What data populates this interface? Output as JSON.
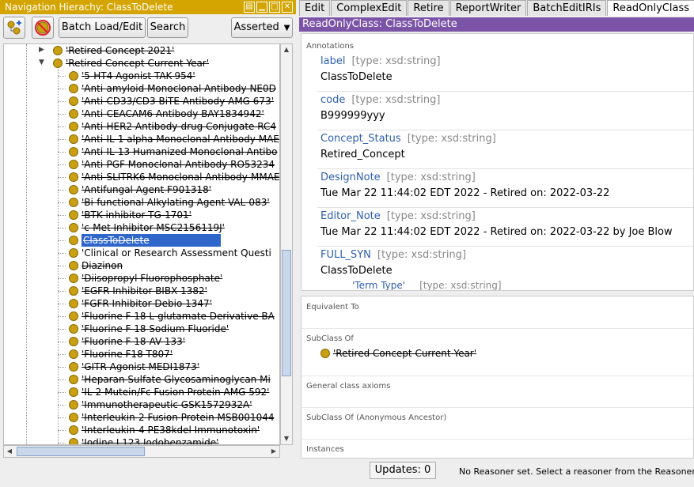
{
  "nav": {
    "title": "Navigation Hierachy: ClassToDelete",
    "batch_label": "Batch Load/Edit",
    "search_label": "Search",
    "asserted_label": "Asserted"
  },
  "tree": {
    "parents": [
      {
        "label": "'Retired Concept 2021'",
        "retired": true,
        "expanded": false
      },
      {
        "label": "'Retired Concept Current Year'",
        "retired": true,
        "expanded": true
      }
    ],
    "children": [
      {
        "label": "'5-HT4 Agonist TAK-954'",
        "retired": true
      },
      {
        "label": "'Anti-amyloid Monoclonal Antibody NE0D",
        "retired": true
      },
      {
        "label": "'Anti-CD33/CD3 BiTE Antibody AMG 673'",
        "retired": true
      },
      {
        "label": "'Anti-CEACAM6 Antibody BAY1834942'",
        "retired": true
      },
      {
        "label": "'Anti-HER2 Antibody-drug Conjugate RC4",
        "retired": true
      },
      {
        "label": "'Anti-IL-1 alpha Monoclonal Antibody MAE",
        "retired": true
      },
      {
        "label": "'Anti-IL-13 Humanized Monoclonal Antibo",
        "retired": true
      },
      {
        "label": "'Anti-PGF Monoclonal Antibody RO53234",
        "retired": true
      },
      {
        "label": "'Anti-SLITRK6 Monoclonal Antibody-MMAE",
        "retired": true
      },
      {
        "label": "'Antifungal Agent F901318'",
        "retired": true
      },
      {
        "label": "'Bi-functional Alkylating Agent VAL-083'",
        "retired": true
      },
      {
        "label": "'BTK inhibitor TG-1701'",
        "retired": true
      },
      {
        "label": "'c-Met Inhibitor MSC2156119J'",
        "retired": true
      },
      {
        "label": "ClassToDelete",
        "retired": true,
        "selected": true
      },
      {
        "label": "'Clinical or Research Assessment Questi",
        "retired": false
      },
      {
        "label": "Diazinon",
        "retired": true
      },
      {
        "label": "'Diisopropyl Fluorophosphate'",
        "retired": true
      },
      {
        "label": "'EGFR Inhibitor BIBX 1382'",
        "retired": true
      },
      {
        "label": "'FGFR Inhibitor Debio 1347'",
        "retired": true
      },
      {
        "label": "'Fluorine F 18 L-glutamate Derivative BA",
        "retired": true
      },
      {
        "label": "'Fluorine F 18 Sodium Fluoride'",
        "retired": true
      },
      {
        "label": "'Fluorine F 18-AV-133'",
        "retired": true
      },
      {
        "label": "'Fluorine F18 T807'",
        "retired": true
      },
      {
        "label": "'GITR Agonist MEDI1873'",
        "retired": true
      },
      {
        "label": "'Heparan Sulfate Glycosaminoglycan Mi",
        "retired": true
      },
      {
        "label": "'IL-2 Mutein/Fc Fusion Protein AMG 592'",
        "retired": true
      },
      {
        "label": "'Immunotherapeutic GSK1572932A'",
        "retired": true
      },
      {
        "label": "'Interleukin-2 Fusion Protein MSB001044",
        "retired": true
      },
      {
        "label": "'Interleukin-4 PE38kdel Immunotoxin'",
        "retired": true
      },
      {
        "label": "'Iodine I 123 Iodobenzamide'",
        "retired": true
      }
    ]
  },
  "tabs": [
    "Edit",
    "ComplexEdit",
    "Retire",
    "ReportWriter",
    "BatchEditIRIs",
    "ReadOnlyClass"
  ],
  "readonly": {
    "title": "ReadOnlyClass: ClassToDelete",
    "annotations_title": "Annotations",
    "annotations": [
      {
        "prop": "label",
        "type": "[type: xsd:string]",
        "value": "ClassToDelete"
      },
      {
        "prop": "code",
        "type": "[type: xsd:string]",
        "value": "B999999yyy"
      },
      {
        "prop": "Concept_Status",
        "type": "[type: xsd:string]",
        "value": "Retired_Concept"
      },
      {
        "prop": "DesignNote",
        "type": "[type: xsd:string]",
        "value": "Tue Mar 22 11:44:02 EDT 2022 - Retired on: 2022-03-22"
      },
      {
        "prop": "Editor_Note",
        "type": "[type: xsd:string]",
        "value": "Tue Mar 22 11:44:02 EDT 2022 - Retired on: 2022-03-22 by Joe Blow"
      },
      {
        "prop": "FULL_SYN",
        "type": "[type: xsd:string]",
        "value": "ClassToDelete"
      }
    ],
    "nested": {
      "prop": "'Term Type'",
      "type": "[type: xsd:string]"
    },
    "equivalent_to": "Equivalent To",
    "subclass_of": "SubClass Of",
    "subclass_value": "'Retired Concept Current Year'",
    "general_axioms": "General class axioms",
    "subclass_anon": "SubClass Of (Anonymous Ancestor)",
    "instances": "Instances"
  },
  "status": {
    "updates": "Updates: 0",
    "reasoner": "No Reasoner set. Select a reasoner from the Reasoner menu"
  },
  "colors": {
    "nav_title_bg": "#d4a500",
    "readonly_title_bg": "#7b54a8",
    "selection": "#2f66c9",
    "class_dot": "#c9a013"
  }
}
